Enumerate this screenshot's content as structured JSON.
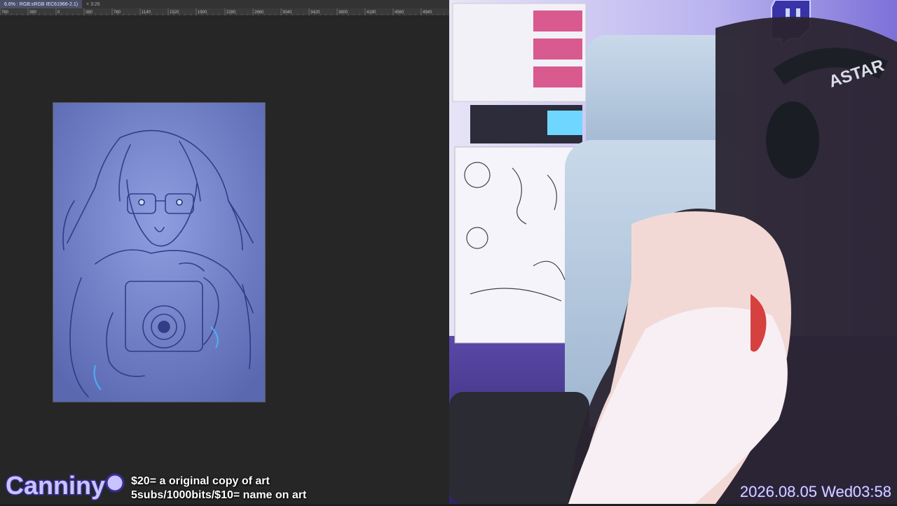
{
  "app": {
    "tabs": [
      {
        "label": "6.6% : RGB:sRGB IEC61966-2.1)",
        "active": true
      },
      {
        "label": "× 3:26",
        "active": false
      }
    ],
    "ruler_labels": [
      "760",
      "380",
      "0",
      "380",
      "760",
      "1140",
      "1520",
      "1900",
      "2280",
      "2660",
      "3040",
      "3420",
      "3800",
      "4180",
      "4560",
      "4940"
    ]
  },
  "overlay": {
    "logo_text": "Canniny",
    "donation_line1": "$20= a original copy of art",
    "donation_line2": "5subs/1000bits/$10= name on art",
    "datetime": "2026.08.05 Wed03:58"
  },
  "webcam": {
    "headphone_brand": "ASTAR",
    "twitch_logo": "twitch-logo-icon"
  },
  "colors": {
    "canvas_blue": "#6f7fc4",
    "app_bg": "#262626",
    "datetime": "#d8d4ff"
  }
}
